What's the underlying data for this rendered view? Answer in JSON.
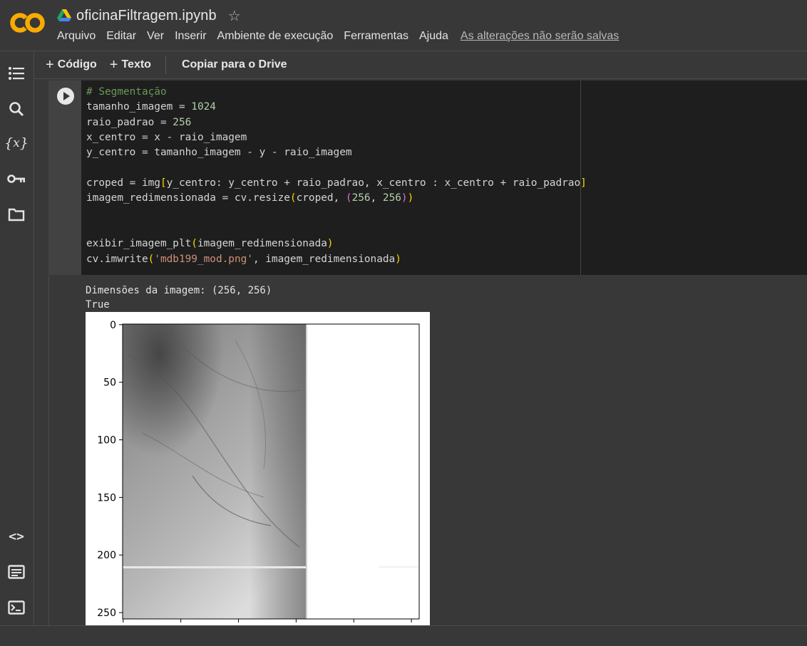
{
  "header": {
    "title": "oficinaFiltragem.ipynb",
    "menu": [
      "Arquivo",
      "Editar",
      "Ver",
      "Inserir",
      "Ambiente de execução",
      "Ferramentas",
      "Ajuda"
    ],
    "unsaved_notice": "As alterações não serão salvas"
  },
  "sidebar": {
    "icons": [
      "toc-icon",
      "search-icon",
      "variables-icon",
      "key-icon",
      "folder-icon",
      "code-snippets-icon",
      "command-palette-icon",
      "terminal-icon"
    ]
  },
  "toolbar": {
    "code_label": "Código",
    "text_label": "Texto",
    "copy_drive_label": "Copiar para o Drive"
  },
  "cell": {
    "code_lines": [
      "# Segmentação",
      "tamanho_imagem = 1024",
      "raio_padrao = 256",
      "x_centro = x - raio_imagem",
      "y_centro = tamanho_imagem - y - raio_imagem",
      "",
      "croped = img[y_centro: y_centro + raio_padrao, x_centro : x_centro + raio_padrao]",
      "imagem_redimensionada = cv.resize(croped, (256, 256))",
      "",
      "",
      "exibir_imagem_plt(imagem_redimensionada)",
      "cv.imwrite('mdb199_mod.png', imagem_redimensionada)"
    ]
  },
  "output": {
    "line1": "Dimensões da imagem: (256, 256)",
    "line2": "True"
  },
  "chart_data": {
    "type": "image",
    "y_ticks": [
      "0",
      "50",
      "100",
      "150",
      "200",
      "250"
    ],
    "ylim": [
      0,
      256
    ],
    "colormap": "gray"
  }
}
